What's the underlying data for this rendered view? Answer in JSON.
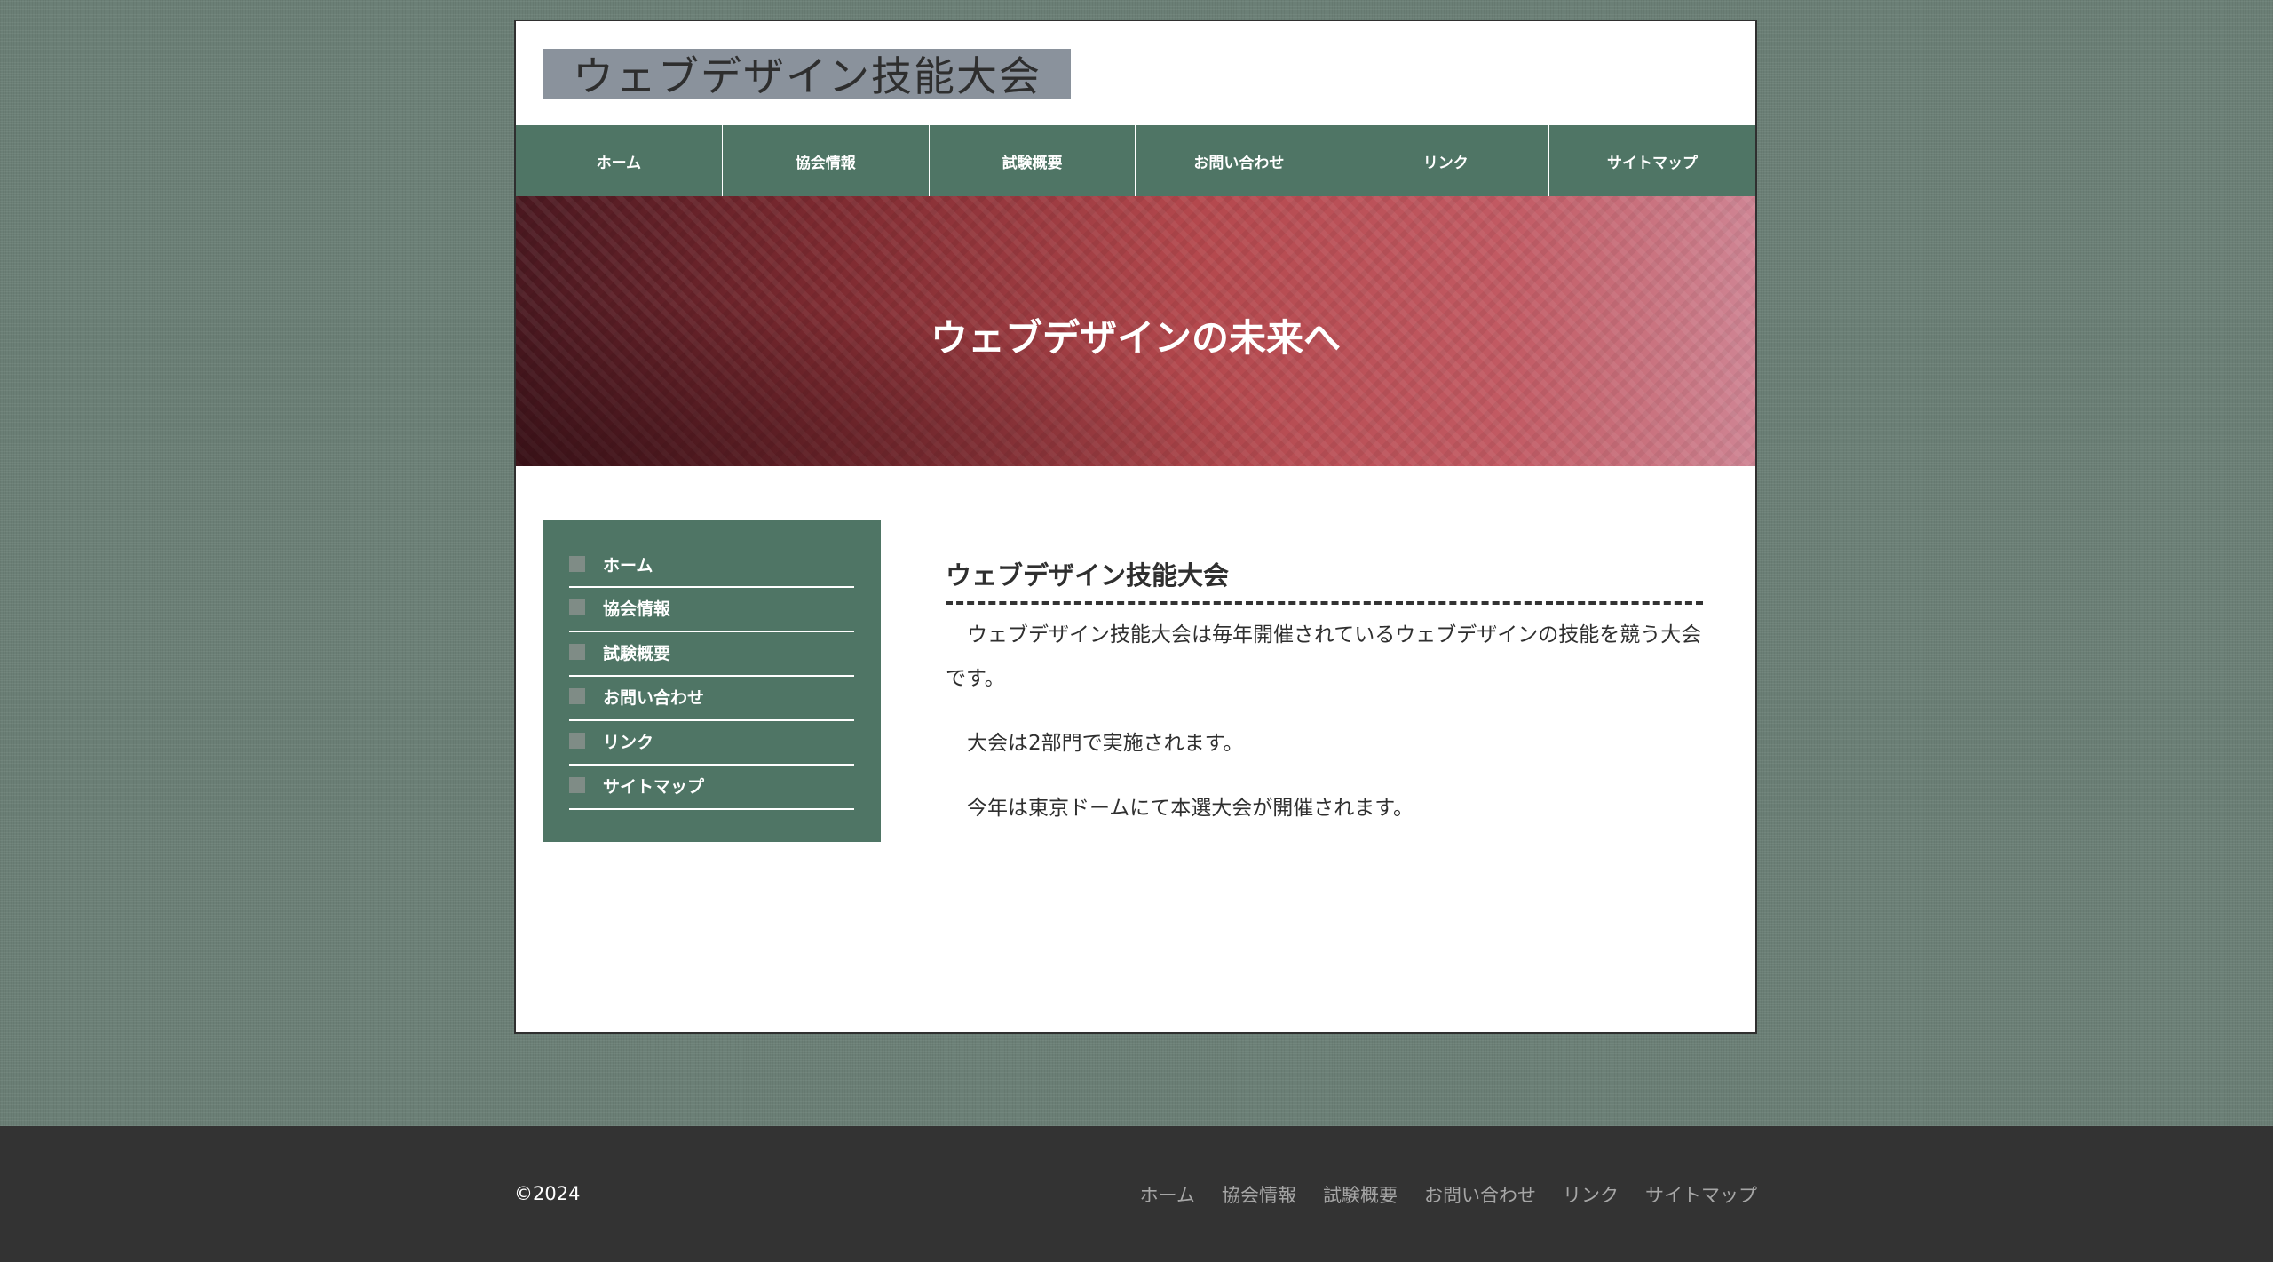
{
  "header": {
    "logo_text": "ウェブデザイン技能大会"
  },
  "global_nav": {
    "items": [
      {
        "label": "ホーム"
      },
      {
        "label": "協会情報"
      },
      {
        "label": "試験概要"
      },
      {
        "label": "お問い合わせ"
      },
      {
        "label": "リンク"
      },
      {
        "label": "サイトマップ"
      }
    ]
  },
  "hero": {
    "title": "ウェブデザインの未来へ"
  },
  "sidebar": {
    "items": [
      {
        "label": "ホーム"
      },
      {
        "label": "協会情報"
      },
      {
        "label": "試験概要"
      },
      {
        "label": "お問い合わせ"
      },
      {
        "label": "リンク"
      },
      {
        "label": "サイトマップ"
      }
    ]
  },
  "main": {
    "heading": "ウェブデザイン技能大会",
    "paragraphs": [
      "ウェブデザイン技能大会は毎年開催されているウェブデザインの技能を競う大会です。",
      "大会は2部門で実施されます。",
      "今年は東京ドームにて本選大会が開催されます。"
    ]
  },
  "footer": {
    "copyright": "©2024",
    "nav": [
      {
        "label": "ホーム"
      },
      {
        "label": "協会情報"
      },
      {
        "label": "試験概要"
      },
      {
        "label": "お問い合わせ"
      },
      {
        "label": "リンク"
      },
      {
        "label": "サイトマップ"
      }
    ]
  },
  "colors": {
    "background": "#6b7f76",
    "nav_green": "#4f7565",
    "footer": "#333333",
    "hero_red": "#b4484d"
  }
}
